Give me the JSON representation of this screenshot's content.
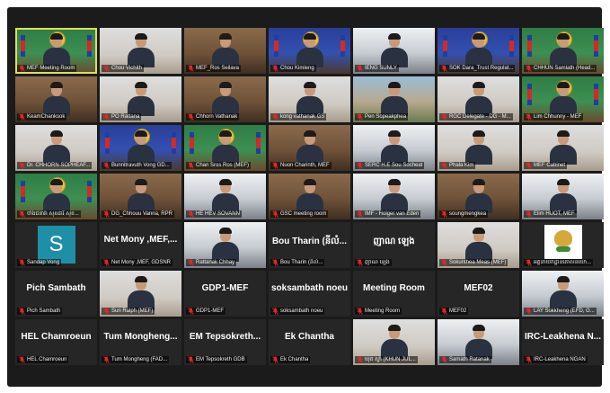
{
  "tiles": [
    {
      "name": "MEF Meeting Room",
      "scene": "green-banner",
      "active": true,
      "mic": "off"
    },
    {
      "name": "Chou Vichith",
      "scene": "white-wall",
      "mic": "off"
    },
    {
      "name": "MEF_Ros Seilava",
      "scene": "office-brown",
      "mic": "off"
    },
    {
      "name": "Chou Kimleng",
      "scene": "blue-banner",
      "mic": "off"
    },
    {
      "name": "IENG SUNLY",
      "scene": "bright-room",
      "mic": "off"
    },
    {
      "name": "SOK Dara_Trust Regulat...",
      "scene": "blue-banner",
      "mic": "off"
    },
    {
      "name": "CHHUN Samlath (Head...",
      "scene": "green-banner",
      "mic": "off"
    },
    {
      "name": "KeamChanksok",
      "scene": "office-brown",
      "mic": "off"
    },
    {
      "name": "PO Rattana",
      "scene": "white-wall",
      "mic": "off"
    },
    {
      "name": "Chhorn Vathanak",
      "scene": "office-brown",
      "mic": "off"
    },
    {
      "name": "kong vathanak GS",
      "scene": "white-wall",
      "mic": "off"
    },
    {
      "name": "Pen Sopeakphea",
      "scene": "outdoor",
      "mic": "off"
    },
    {
      "name": "RGC Delegate - DG - M...",
      "scene": "white-wall",
      "mic": "off"
    },
    {
      "name": "Lim Chhunny - MEF",
      "scene": "green-banner",
      "mic": "off"
    },
    {
      "name": "Dr. CHHORN SOPHEAF...",
      "scene": "white-wall",
      "mic": "off"
    },
    {
      "name": "Bunnitravuth Vong GD...",
      "scene": "blue-banner",
      "mic": "off"
    },
    {
      "name": "Chan Sros Ros (MEF)",
      "scene": "green-banner",
      "mic": "off"
    },
    {
      "name": "Nuon Charinth, MEF",
      "scene": "office-brown",
      "mic": "off"
    },
    {
      "name": "SERC H.E Sou Socheat",
      "scene": "bright-room",
      "mic": "off"
    },
    {
      "name": "Phala Kim",
      "scene": "white-wall",
      "mic": "off"
    },
    {
      "name": "MEF Cabinet",
      "scene": "white-wall",
      "mic": "off"
    },
    {
      "name": "ចាំងជនារ៉ា សុខដារិ សុខ...",
      "scene": "green-banner",
      "mic": "off"
    },
    {
      "name": "DG_Chhouu Vanna, RPR",
      "scene": "office-brown",
      "mic": "off"
    },
    {
      "name": "HE HEV SOVANN",
      "scene": "bright-room",
      "mic": "off"
    },
    {
      "name": "GSC meeting room",
      "scene": "office-brown",
      "mic": "off"
    },
    {
      "name": "IMF - Holger van Eden",
      "scene": "bright-room",
      "mic": "off"
    },
    {
      "name": "soungmengkea",
      "scene": "office-brown",
      "mic": "off"
    },
    {
      "name": "Elim HUOT, MEF",
      "scene": "bright-room",
      "mic": "off"
    },
    {
      "name": "Sandap Vong",
      "scene": "avatar-s",
      "avatar_letter": "S",
      "mic": "off"
    },
    {
      "name": "Net Mony ,MEF, GDSNR",
      "title": "Net Mony ,MEF,...",
      "scene": "name-only",
      "mic": "off"
    },
    {
      "name": "Rattanak Chhay",
      "scene": "bright-room",
      "mic": "off"
    },
    {
      "name": "Bou Tharin (នីលំ...",
      "title": "Bou Tharin (នីលំ...",
      "scene": "name-only",
      "mic": "off"
    },
    {
      "name": "ញាណ ឡេង",
      "title": "ញាណ ឡេង",
      "scene": "name-only",
      "mic": "off"
    },
    {
      "name": "Sokunthea Meas (MEF)",
      "scene": "white-wall",
      "mic": "off"
    },
    {
      "name": "អគ្គនាយកដ្ឋានគោលនយោ...",
      "scene": "logo",
      "mic": "off"
    },
    {
      "name": "Pich Sambath",
      "title": "Pich Sambath",
      "scene": "name-only",
      "mic": "off"
    },
    {
      "name": "Sun Ralph (MEF)",
      "scene": "white-wall",
      "mic": "off"
    },
    {
      "name": "GDP1-MEF",
      "title": "GDP1-MEF",
      "scene": "name-only",
      "mic": "off"
    },
    {
      "name": "soksambath noeu",
      "title": "soksambath noeu",
      "scene": "name-only",
      "mic": "off"
    },
    {
      "name": "Meeting Room",
      "title": "Meeting Room",
      "scene": "name-only",
      "mic": "off"
    },
    {
      "name": "MEF02",
      "title": "MEF02",
      "scene": "name-only",
      "mic": "off"
    },
    {
      "name": "LAY Sokkheng (EFD, G...",
      "scene": "bright-room",
      "mic": "off"
    },
    {
      "name": "HEL Chamroeun",
      "title": "HEL Chamroeun",
      "scene": "name-only",
      "mic": "off"
    },
    {
      "name": "Tum Mongheng (FAD...",
      "title": "Tum Mongheng...",
      "scene": "name-only",
      "mic": "off"
    },
    {
      "name": "EM Tepsokreth GDB",
      "title": "EM Tepsokreth...",
      "scene": "name-only",
      "mic": "off"
    },
    {
      "name": "Ek Chantha",
      "title": "Ek Chantha",
      "scene": "name-only",
      "mic": "off"
    },
    {
      "name": "ឃុត ស្វាំ (KHUN JUL...",
      "scene": "white-wall",
      "mic": "off"
    },
    {
      "name": "Samath Ratanak",
      "scene": "bright-room",
      "mic": "off"
    },
    {
      "name": "IRC-Leakhena NGAN",
      "title": "IRC-Leakhena N...",
      "scene": "name-only",
      "mic": "off"
    }
  ],
  "colors": {
    "window_bg": "#1b1b1b",
    "active_outline": "#d9e15a",
    "mic_off": "#e02828"
  }
}
